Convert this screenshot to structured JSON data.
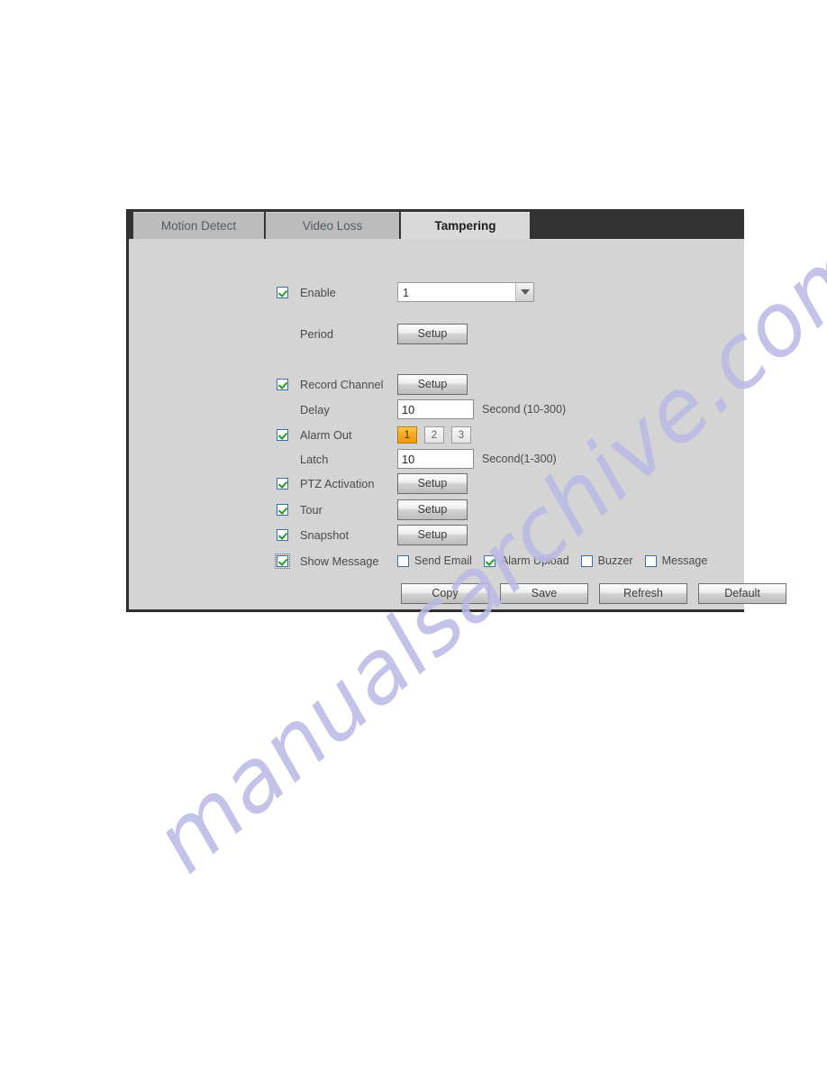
{
  "panel": {
    "tabs": [
      {
        "id": "motion-detect",
        "label": "Motion Detect",
        "active": false
      },
      {
        "id": "video-loss",
        "label": "Video Loss",
        "active": false
      },
      {
        "id": "tampering",
        "label": "Tampering",
        "active": true
      }
    ],
    "rows": {
      "enable": {
        "label": "Enable",
        "checked": true,
        "channel_value": "1"
      },
      "period": {
        "label": "Period",
        "button": "Setup"
      },
      "record_channel": {
        "label": "Record Channel",
        "checked": true,
        "button": "Setup"
      },
      "delay": {
        "label": "Delay",
        "value": "10",
        "suffix": "Second (10-300)"
      },
      "alarm_out": {
        "label": "Alarm Out",
        "checked": true,
        "outputs": [
          "1",
          "2",
          "3"
        ],
        "selected": "1"
      },
      "latch": {
        "label": "Latch",
        "value": "10",
        "suffix": "Second(1-300)"
      },
      "ptz_activation": {
        "label": "PTZ Activation",
        "checked": true,
        "button": "Setup"
      },
      "tour": {
        "label": "Tour",
        "checked": true,
        "button": "Setup"
      },
      "snapshot": {
        "label": "Snapshot",
        "checked": true,
        "button": "Setup"
      },
      "show_message": {
        "label": "Show Message",
        "checked": true,
        "options": [
          {
            "label": "Send Email",
            "checked": false
          },
          {
            "label": "Alarm Upload",
            "checked": true
          },
          {
            "label": "Buzzer",
            "checked": false
          },
          {
            "label": "Message",
            "checked": false
          }
        ]
      }
    },
    "actions": [
      {
        "id": "copy",
        "label": "Copy"
      },
      {
        "id": "save",
        "label": "Save"
      },
      {
        "id": "refresh",
        "label": "Refresh"
      },
      {
        "id": "default",
        "label": "Default"
      }
    ]
  },
  "watermark": {
    "text": "manualsarchive.com"
  },
  "colors": {
    "tabbar": "#333333",
    "panel_bg": "#d4d4d4",
    "accent_selected": "#f5a623",
    "checkbox_border": "#3b6ea5",
    "check_mark": "#1f9c27",
    "watermark": "#b9b9e6"
  }
}
